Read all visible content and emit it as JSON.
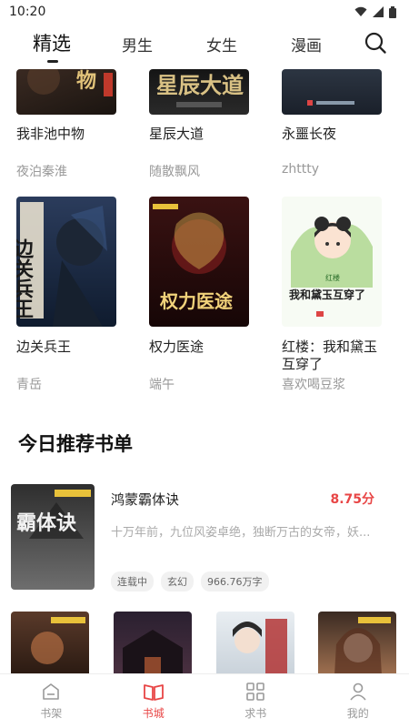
{
  "status": {
    "time": "10:20"
  },
  "tabs": [
    {
      "label": "精选",
      "active": true
    },
    {
      "label": "男生"
    },
    {
      "label": "女生"
    },
    {
      "label": "漫画"
    }
  ],
  "books_row1": [
    {
      "title": "我非池中物",
      "author": "夜泊秦淮",
      "cover_text": "物"
    },
    {
      "title": "星辰大道",
      "author": "随散飘风",
      "cover_text": "星辰大道"
    },
    {
      "title": "永噩长夜",
      "author": "zhttty",
      "cover_text": ""
    }
  ],
  "books_row2": [
    {
      "title": "边关兵王",
      "author": "青岳",
      "cover_text": "边关兵王"
    },
    {
      "title": "权力医途",
      "author": "端午",
      "cover_text": "权力医途"
    },
    {
      "title": "红楼：我和黛玉互穿了",
      "author": "喜欢喝豆浆",
      "cover_text": "我和黛玉互穿了",
      "cover_sub": "红楼"
    }
  ],
  "section": {
    "title": "今日推荐书单"
  },
  "recommend": {
    "title": "鸿蒙霸体诀",
    "score": "8.75分",
    "desc": "十万年前，九位风姿卓绝，独断万古的女帝，妖...",
    "tags": [
      "连载中",
      "玄幻",
      "966.76万字"
    ],
    "cover_text": "霸体诀"
  },
  "bottom_nav": [
    {
      "label": "书架",
      "icon": "bookshelf-icon"
    },
    {
      "label": "书城",
      "icon": "open-book-icon",
      "active": true
    },
    {
      "label": "求书",
      "icon": "grid-icon"
    },
    {
      "label": "我的",
      "icon": "person-icon"
    }
  ],
  "colors": {
    "accent": "#e84545",
    "muted": "#999999"
  }
}
